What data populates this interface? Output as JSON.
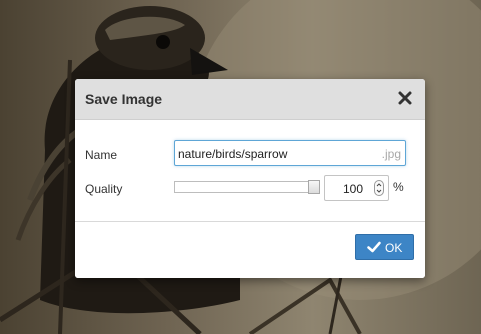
{
  "dialog": {
    "title": "Save Image",
    "close_icon": "close-icon",
    "name_label": "Name",
    "name_value": "nature/birds/sparrow",
    "name_extension": ".jpg",
    "quality_label": "Quality",
    "quality_slider_level": 1.0,
    "quality_value": "100",
    "quality_unit": "%",
    "ok_label": "OK",
    "ok_icon": "checkmark-icon"
  },
  "colors": {
    "primary_button": "#3d85c6",
    "header": "#dfdfdf",
    "focus_border": "#5ea6d6"
  }
}
